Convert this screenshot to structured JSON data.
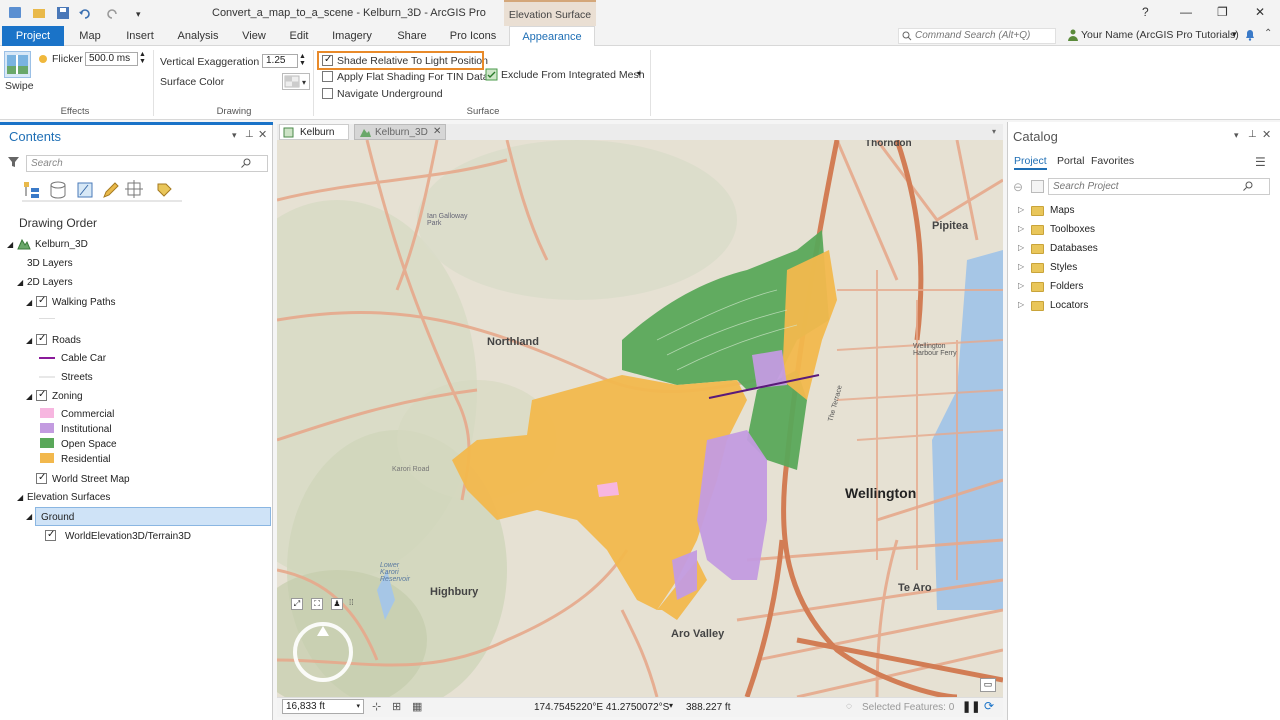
{
  "window": {
    "title": "Convert_a_map_to_a_scene - Kelburn_3D - ArcGIS Pro",
    "contextual_tab_title": "Elevation Surface",
    "help": "?",
    "minimize": "—",
    "restore": "❐",
    "close": "✕"
  },
  "ribbon": {
    "tabs": [
      "Project",
      "Map",
      "Insert",
      "Analysis",
      "View",
      "Edit",
      "Imagery",
      "Share",
      "Pro Icons",
      "Appearance"
    ],
    "command_search_placeholder": "Command Search (Alt+Q)",
    "user_name": "Your Name (ArcGIS Pro Tutorials)",
    "effects": {
      "label": "Effects",
      "swipe": "Swipe",
      "flicker": "Flicker",
      "flicker_value": "500.0  ms"
    },
    "drawing": {
      "label": "Drawing",
      "vertical_exaggeration": "Vertical Exaggeration",
      "vertical_exaggeration_value": "1.25",
      "surface_color": "Surface Color"
    },
    "surface": {
      "label": "Surface",
      "shade_relative": "Shade Relative To Light Position",
      "shade_relative_checked": true,
      "flat_shading": "Apply Flat Shading For TIN Data",
      "flat_shading_checked": false,
      "navigate_underground": "Navigate Underground",
      "navigate_underground_checked": false,
      "exclude_mesh": "Exclude From Integrated Mesh"
    }
  },
  "contents": {
    "title": "Contents",
    "search_placeholder": "Search",
    "section": "Drawing Order",
    "scene": "Kelburn_3D",
    "layers_3d": "3D Layers",
    "layers_2d": "2D Layers",
    "walking_paths": "Walking Paths",
    "roads": "Roads",
    "cable_car": "Cable Car",
    "streets": "Streets",
    "zoning": "Zoning",
    "zoning_classes": [
      {
        "label": "Commercial",
        "color": "#f7b6e0"
      },
      {
        "label": "Institutional",
        "color": "#c39be0"
      },
      {
        "label": "Open Space",
        "color": "#5aa85a"
      },
      {
        "label": "Residential",
        "color": "#f2b84d"
      }
    ],
    "world_street_map": "World Street Map",
    "elevation_surfaces": "Elevation Surfaces",
    "ground": "Ground",
    "terrain": "WorldElevation3D/Terrain3D"
  },
  "map": {
    "tabs": [
      "Kelburn",
      "Kelburn_3D"
    ],
    "places": {
      "thorndon": "Thorndon",
      "pipitea": "Pipitea",
      "northland": "Northland",
      "wellington": "Wellington",
      "highbury": "Highbury",
      "te_aro": "Te Aro",
      "aro_valley": "Aro Valley",
      "ian_galloway": "Ian Galloway\nPark",
      "lower_karori": "Lower\nKarori\nReservoir",
      "karori_road": "Karori Road",
      "wellington_harbour": "Wellington\nHarbour Ferry",
      "the_terrace": "The Terrace"
    },
    "scale": "16,833 ft",
    "coordinates": "174.7545220°E 41.2750072°S",
    "elevation": "388.227 ft",
    "selected_features": "Selected Features: 0"
  },
  "catalog": {
    "title": "Catalog",
    "tabs": [
      "Project",
      "Portal",
      "Favorites"
    ],
    "search_placeholder": "Search Project",
    "items": [
      "Maps",
      "Toolboxes",
      "Databases",
      "Styles",
      "Folders",
      "Locators"
    ]
  }
}
